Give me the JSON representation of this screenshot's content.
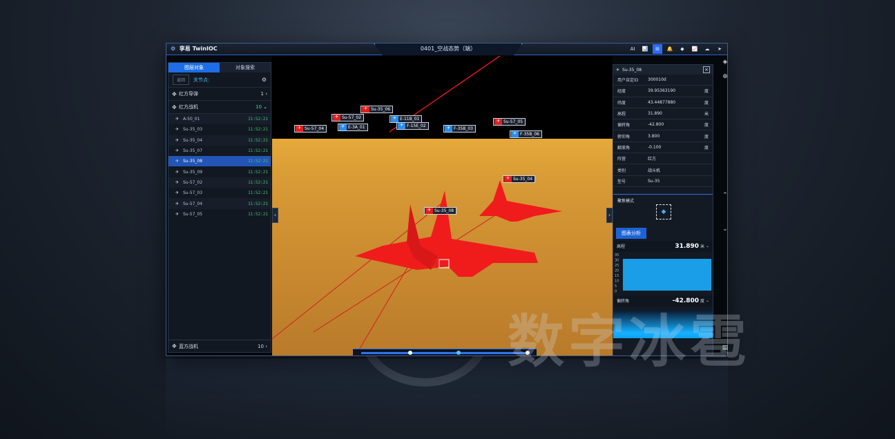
{
  "window": {
    "brand": "孪易 TwinIOC",
    "title": "0401_空战态势（端）",
    "tools": [
      "AI",
      "📊",
      "⊞",
      "🔔",
      "◆",
      "📈",
      "☁",
      "➤"
    ]
  },
  "left_panel": {
    "tabs": [
      "图层对象",
      "对象搜索"
    ],
    "back_label": "返回",
    "focus_label": "关节点:",
    "groups": [
      {
        "name": "红方导弹",
        "count": "1"
      },
      {
        "name": "红方战机",
        "count": "10"
      }
    ],
    "items": [
      {
        "name": "A-50_01",
        "time": "11:52:21"
      },
      {
        "name": "Su-35_03",
        "time": "11:52:21"
      },
      {
        "name": "Su-35_04",
        "time": "11:52:21"
      },
      {
        "name": "Su-35_07",
        "time": "11:52:21"
      },
      {
        "name": "Su-35_08",
        "time": "11:52:21"
      },
      {
        "name": "Su-35_09",
        "time": "11:52:21"
      },
      {
        "name": "Su-57_02",
        "time": "11:52:21"
      },
      {
        "name": "Su-57_03",
        "time": "11:52:21"
      },
      {
        "name": "Su-57_04",
        "time": "11:52:21"
      },
      {
        "name": "Su-57_05",
        "time": "11:52:21"
      }
    ],
    "selected_index": 4,
    "bottom_group": {
      "name": "蓝方战机",
      "count": "10"
    }
  },
  "scene": {
    "tags": [
      {
        "label": "Su-35_06",
        "team": "red"
      },
      {
        "label": "Su-57_02",
        "team": "red"
      },
      {
        "label": "E-11B_01",
        "team": "blue"
      },
      {
        "label": "F-15E_02",
        "team": "blue"
      },
      {
        "label": "Su-57_04",
        "team": "red"
      },
      {
        "label": "E-3A_01",
        "team": "blue"
      },
      {
        "label": "F-35B_03",
        "team": "blue"
      },
      {
        "label": "Su-57_05",
        "team": "red"
      },
      {
        "label": "F-35B_06",
        "team": "blue"
      },
      {
        "label": "Su-35_04",
        "team": "red"
      },
      {
        "label": "Su-35_08",
        "team": "red"
      }
    ]
  },
  "right_panel": {
    "title": "Su-35_08",
    "props": [
      {
        "k": "用户自定ID",
        "v": "300010d",
        "u": ""
      },
      {
        "k": "经度",
        "v": "39.95363190",
        "u": "度"
      },
      {
        "k": "纬度",
        "v": "43.44877880",
        "u": "度"
      },
      {
        "k": "高程",
        "v": "31.890",
        "u": "米"
      },
      {
        "k": "偏转角",
        "v": "-42.800",
        "u": "度"
      },
      {
        "k": "俯仰角",
        "v": "3.800",
        "u": "度"
      },
      {
        "k": "翻滚角",
        "v": "-0.100",
        "u": "度"
      },
      {
        "k": "阵营",
        "v": "红方",
        "u": ""
      },
      {
        "k": "类别",
        "v": "战斗机",
        "u": ""
      },
      {
        "k": "型号",
        "v": "Su-35",
        "u": ""
      }
    ],
    "focus_mode_label": "聚焦模式",
    "chart_tab": "图表分析",
    "metric1": {
      "label": "高程",
      "value": "31.890",
      "unit": "米"
    },
    "metric2": {
      "label": "偏转角",
      "value": "-42.800",
      "unit": "度"
    },
    "yticks": [
      "35",
      "30",
      "25",
      "20",
      "15",
      "10",
      "5",
      "0"
    ]
  },
  "watermark": "数字冰雹"
}
